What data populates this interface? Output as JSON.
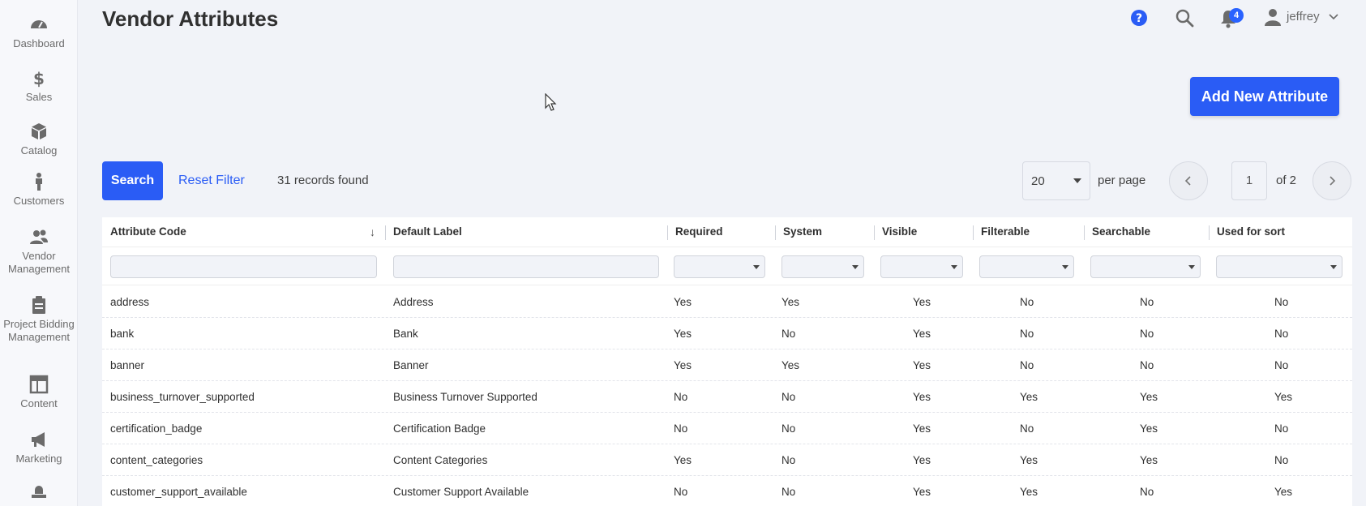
{
  "sidebar": {
    "items": [
      {
        "label": "Dashboard",
        "icon": "dashboard-icon"
      },
      {
        "label": "Sales",
        "icon": "dollar-icon"
      },
      {
        "label": "Catalog",
        "icon": "box-icon"
      },
      {
        "label": "Customers",
        "icon": "person-icon"
      },
      {
        "label": "Vendor Management",
        "icon": "users-icon"
      },
      {
        "label": "Project Bidding Management",
        "icon": "clipboard-icon"
      },
      {
        "label": "Content",
        "icon": "layout-icon"
      },
      {
        "label": "Marketing",
        "icon": "megaphone-icon"
      },
      {
        "label": "",
        "icon": "stores-icon"
      }
    ]
  },
  "header": {
    "title": "Vendor Attributes",
    "notification_count": "4",
    "user_name": "jeffrey",
    "accent_color": "#2a5cf5"
  },
  "actions": {
    "add_new": "Add New Attribute"
  },
  "toolbar": {
    "search_label": "Search",
    "reset_label": "Reset Filter",
    "records_text": "31 records found",
    "per_page_value": "20",
    "per_page_label": "per page",
    "page_current": "1",
    "page_of": "of 2"
  },
  "table": {
    "columns": [
      "Attribute Code",
      "Default Label",
      "Required",
      "System",
      "Visible",
      "Filterable",
      "Searchable",
      "Used for sort"
    ],
    "rows": [
      [
        "address",
        "Address",
        "Yes",
        "Yes",
        "Yes",
        "No",
        "No",
        "No"
      ],
      [
        "bank",
        "Bank",
        "Yes",
        "No",
        "Yes",
        "No",
        "No",
        "No"
      ],
      [
        "banner",
        "Banner",
        "Yes",
        "Yes",
        "Yes",
        "No",
        "No",
        "No"
      ],
      [
        "business_turnover_supported",
        "Business Turnover Supported",
        "No",
        "No",
        "Yes",
        "Yes",
        "Yes",
        "Yes"
      ],
      [
        "certification_badge",
        "Certification Badge",
        "No",
        "No",
        "Yes",
        "No",
        "Yes",
        "No"
      ],
      [
        "content_categories",
        "Content Categories",
        "Yes",
        "No",
        "Yes",
        "Yes",
        "Yes",
        "No"
      ],
      [
        "customer_support_available",
        "Customer Support Available",
        "No",
        "No",
        "Yes",
        "Yes",
        "No",
        "Yes"
      ]
    ]
  }
}
